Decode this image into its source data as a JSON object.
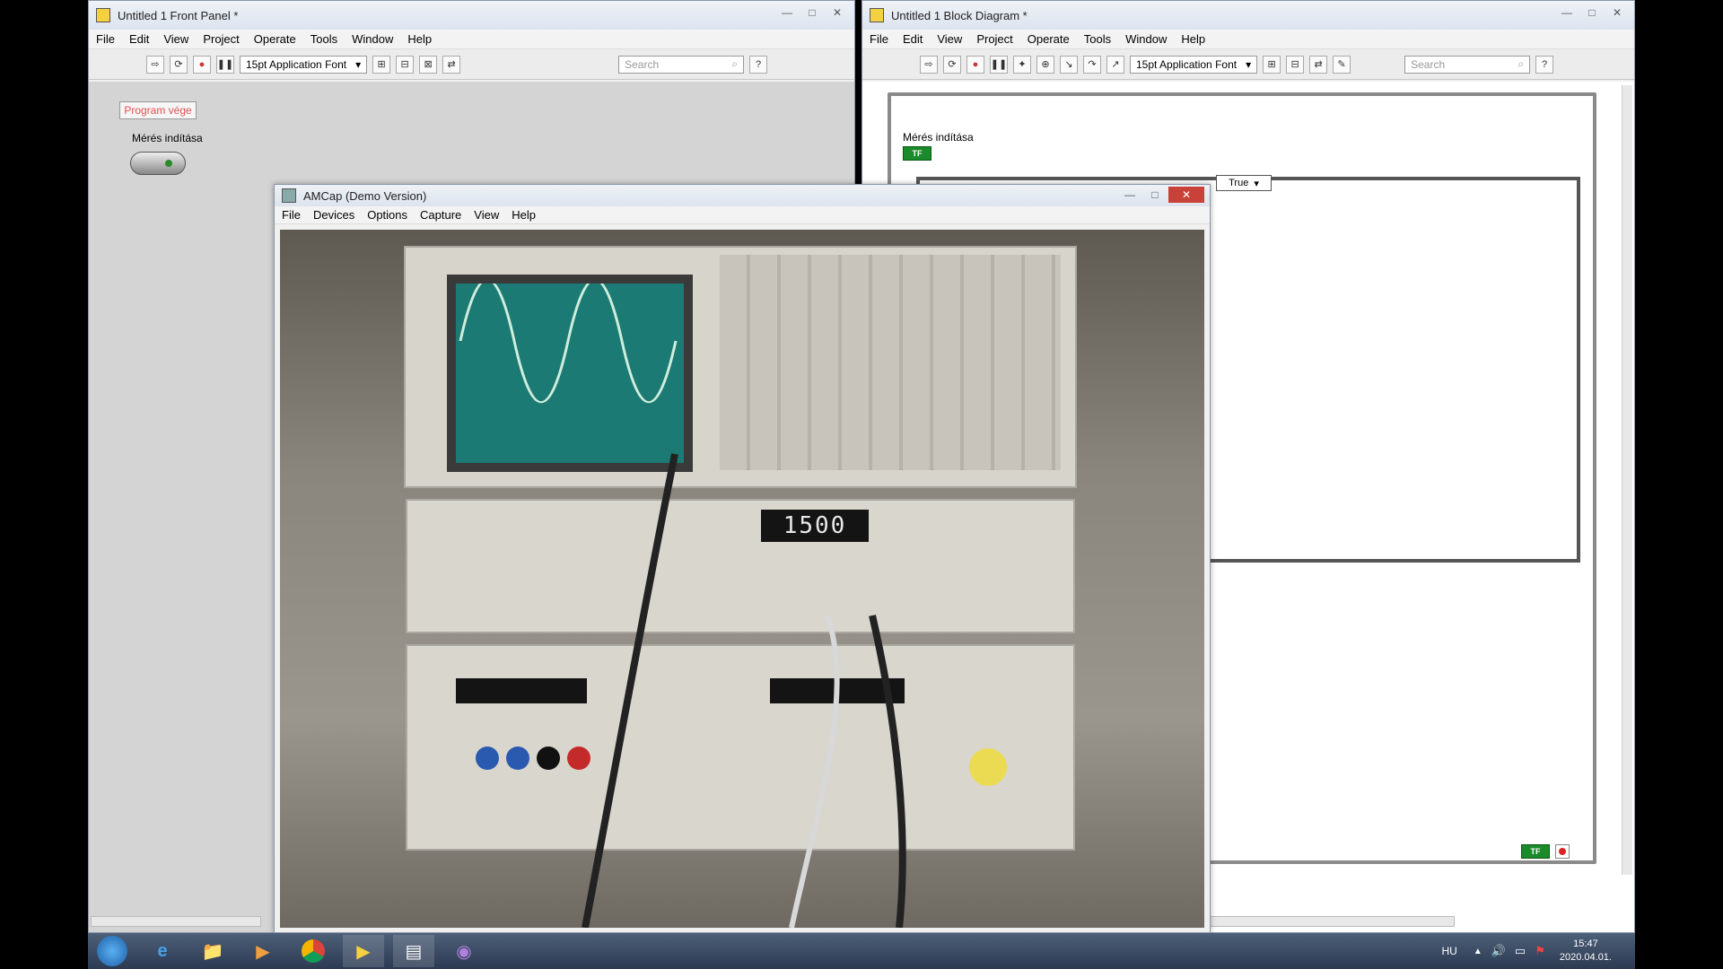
{
  "front_panel": {
    "title": "Untitled 1 Front Panel *",
    "menus": [
      "File",
      "Edit",
      "View",
      "Project",
      "Operate",
      "Tools",
      "Window",
      "Help"
    ],
    "font_select": "15pt Application Font",
    "search_placeholder": "Search",
    "stop_button_label": "Program vége",
    "toggle_label": "Mérés indítása"
  },
  "block_diagram": {
    "title": "Untitled 1 Block Diagram *",
    "menus": [
      "File",
      "Edit",
      "View",
      "Project",
      "Operate",
      "Tools",
      "Window",
      "Help"
    ],
    "font_select": "15pt Application Font",
    "search_placeholder": "Search",
    "terminal_label": "Mérés indítása",
    "terminal_tag": "TF",
    "case_selector": "True",
    "loop_terminal_tag": "TF"
  },
  "amcap": {
    "title": "AMCap (Demo Version)",
    "menus": [
      "File",
      "Devices",
      "Options",
      "Capture",
      "View",
      "Help"
    ],
    "generator_display": "1500"
  },
  "taskbar": {
    "language": "HU",
    "time": "15:47",
    "date": "2020.04.01."
  }
}
